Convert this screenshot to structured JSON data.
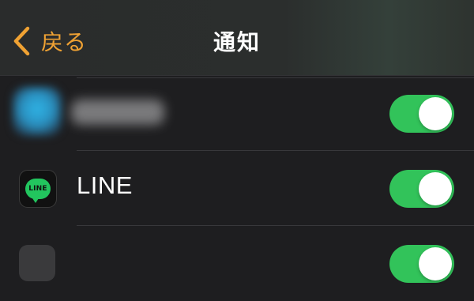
{
  "nav": {
    "back_label": "戻る",
    "title": "通知"
  },
  "colors": {
    "accent": "#f0a233",
    "toggle_on": "#32c35a",
    "background": "#1e1e20",
    "line_brand": "#22c55e"
  },
  "apps": [
    {
      "label": "",
      "icon": "blurred-app-icon",
      "label_blurred": true,
      "enabled": true
    },
    {
      "label": "LINE",
      "icon": "line-app-icon",
      "icon_text": "LINE",
      "enabled": true
    },
    {
      "label": "",
      "icon": "app-icon",
      "enabled": true
    }
  ]
}
